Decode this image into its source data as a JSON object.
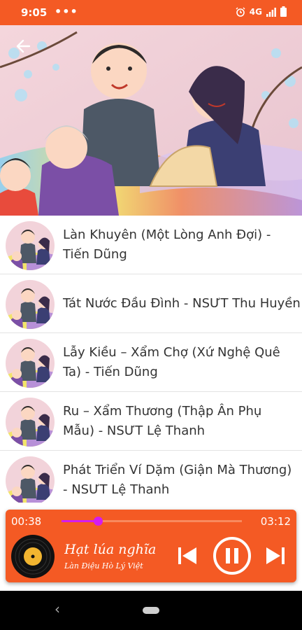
{
  "status": {
    "time": "9:05",
    "dots": "•••",
    "network": "4G"
  },
  "songs": [
    {
      "title": "Làn Khuyên (Một Lòng Anh Đợi) -\nTiến Dũng"
    },
    {
      "title": "Tát Nước Đầu Đình - NSƯT Thu Huyền"
    },
    {
      "title": "Lẫy Kiều – Xẩm Chợ (Xứ Nghệ Quê\nTa) - Tiến Dũng"
    },
    {
      "title": "Ru – Xẩm Thương (Thập Ân Phụ\nMẫu) - NSƯT Lệ Thanh"
    },
    {
      "title": "Phát Triển Ví Dặm (Giận Mà Thương)\n- NSƯT Lệ Thanh"
    }
  ],
  "player": {
    "current_time": "00:38",
    "total_time": "03:12",
    "progress": 0.2,
    "song_title": "Hạt lúa nghĩa",
    "song_subtitle": "Làn Điệu Hò Lý Việt"
  },
  "colors": {
    "accent": "#f45a24",
    "seek": "#d41cf0",
    "disc_label": "#f2b530"
  },
  "icons": [
    "back-arrow-icon",
    "alarm-icon",
    "signal-icon",
    "battery-icon",
    "previous-icon",
    "pause-icon",
    "next-icon",
    "vinyl-disc-icon"
  ]
}
